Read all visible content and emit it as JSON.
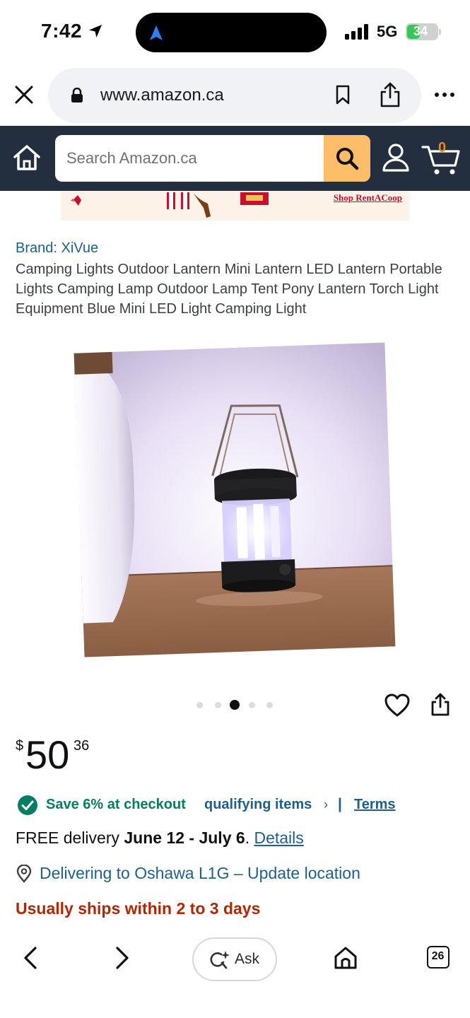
{
  "status_bar": {
    "time": "7:42",
    "network": "5G",
    "battery": "34"
  },
  "browser": {
    "url": "www.amazon.ca"
  },
  "header": {
    "search_placeholder": "Search Amazon.ca",
    "cart_count": "0"
  },
  "ad": {
    "cta": "Shop RentACoop"
  },
  "product": {
    "brand": "Brand: XiVue",
    "title": "Camping Lights Outdoor Lantern Mini Lantern LED Lantern Portable Lights Camping Lamp Outdoor Lamp Tent Pony Lantern Torch Light Equipment Blue Mini LED Light Camping Light",
    "image_count": 5,
    "active_image_index": 2,
    "price_symbol": "$",
    "price_whole": "50",
    "price_fraction": "36",
    "savings_text": "Save 6% at checkout",
    "qualifying_link": "qualifying items",
    "qualifying_chevron": "›",
    "separator": "|",
    "terms_link": "Terms",
    "delivery_prefix": "FREE delivery ",
    "delivery_dates": "June 12 - July 6",
    "delivery_suffix": ". ",
    "details_link": "Details",
    "location_text": "Delivering to Oshawa L1G – Update location",
    "ships_text": "Usually ships within 2 to 3 days"
  },
  "toolbar": {
    "ask_label": "Ask",
    "tab_count": "26"
  },
  "colors": {
    "header_bg": "#232f3e",
    "search_button": "#febd69",
    "cart_count": "#f08804",
    "link": "#1f5f8b",
    "savings_green": "#067d62",
    "ships_red": "#b12704"
  },
  "icons": [
    "location-arrow-icon",
    "navigation-icon",
    "signal-icon",
    "battery-icon",
    "close-icon",
    "lock-icon",
    "bookmark-icon",
    "share-icon",
    "more-icon",
    "home-icon",
    "search-icon",
    "account-icon",
    "cart-icon",
    "heart-icon",
    "check-circle-icon",
    "location-pin-icon",
    "chevron-left-icon",
    "chevron-right-icon",
    "sparkle-search-icon",
    "tabs-icon"
  ]
}
